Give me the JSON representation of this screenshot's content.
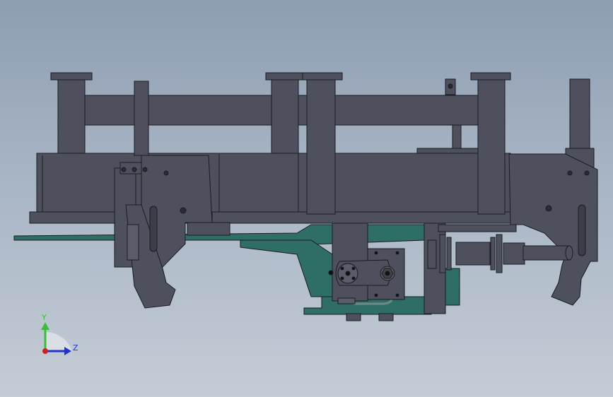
{
  "triad": {
    "y_label": "Y",
    "z_label": "Z",
    "colors": {
      "y": "#3bbd3b",
      "z": "#2233cc",
      "x": "#cc2222"
    }
  },
  "colors": {
    "steel": "#4f505e",
    "steel_light": "#5b5c6a",
    "edge": "#1a1b22",
    "teal": "#2f6e66",
    "teal_dark": "#244f4a"
  }
}
